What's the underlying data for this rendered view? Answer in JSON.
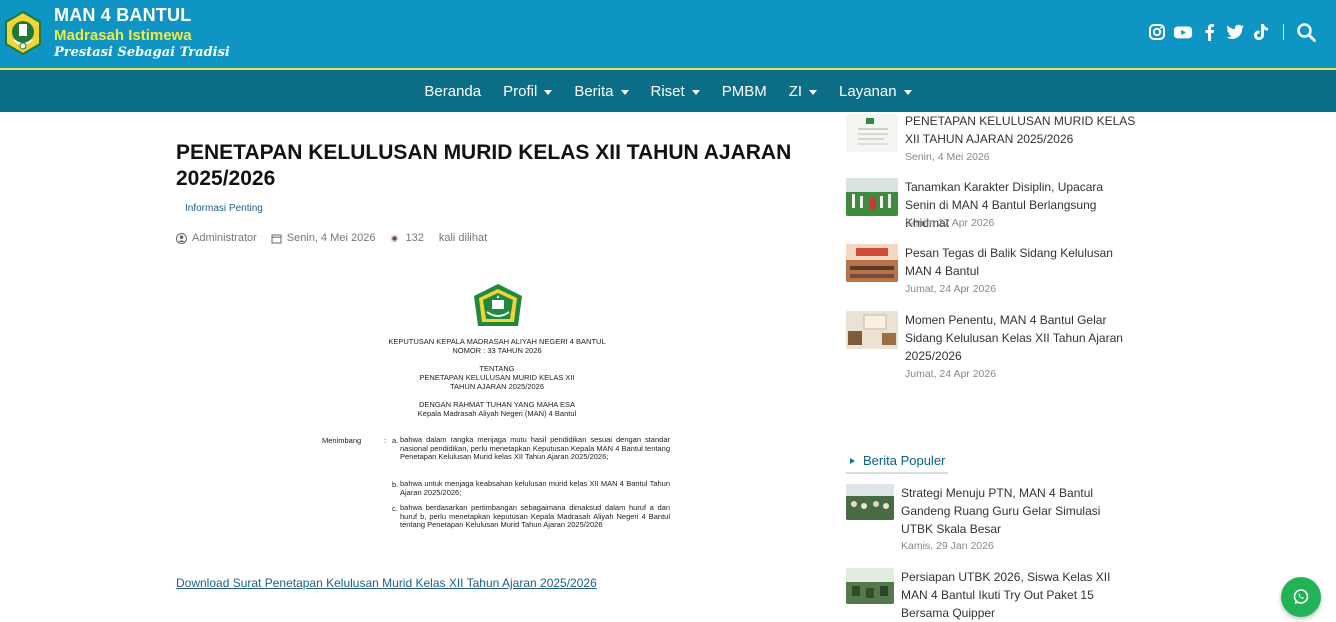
{
  "header": {
    "brand_name": "MAN 4 BANTUL",
    "brand_sub": "Madrasah Istimewa",
    "brand_tagline": "Prestasi Sebagai Tradisi",
    "social_icons": [
      "instagram-icon",
      "youtube-icon",
      "facebook-icon",
      "twitter-icon",
      "tiktok-icon"
    ],
    "colors": {
      "topbar": "#0e95c4",
      "nav": "#0c6d87",
      "accent": "#f4e93b"
    }
  },
  "nav": {
    "items": [
      {
        "label": "Beranda",
        "dropdown": false
      },
      {
        "label": "Profil",
        "dropdown": true
      },
      {
        "label": "Berita",
        "dropdown": true
      },
      {
        "label": "Riset",
        "dropdown": true
      },
      {
        "label": "PMBM",
        "dropdown": false
      },
      {
        "label": "ZI",
        "dropdown": true
      },
      {
        "label": "Layanan",
        "dropdown": true
      }
    ]
  },
  "article": {
    "title": "PENETAPAN KELULUSAN MURID KELAS XII TAHUN AJARAN 2025/2026",
    "category": "Informasi Penting",
    "author": "Administrator",
    "date": "Senin, 4 Mei 2026",
    "views": "132",
    "views_label": "kali dilihat",
    "document": {
      "heading_1": "KEPUTUSAN KEPALA MADRASAH ALIYAH NEGERI 4 BANTUL",
      "heading_2": "NOMOR : 33 TAHUN 2026",
      "tentang": "TENTANG",
      "subject_1": "PENETAPAN KELULUSAN MURID KELAS XII",
      "subject_2": "TAHUN AJARAN 2025/2026",
      "blessing_1": "DENGAN RAHMAT TUHAN YANG MAHA ESA",
      "blessing_2": "Kepala Madrasah Aliyah Negeri (MAN) 4 Bantul",
      "menimbang_label": "Menimbang",
      "colon": ":",
      "points": [
        {
          "letter": "a.",
          "text": "bahwa dalam rangka menjaga mutu hasil pendidikan sesuai dengan standar nasional pendidikan, perlu menetapkan Keputusan Kepala MAN 4 Bantul tentang Penetapan Kelulusan Murid kelas XII Tahun Ajaran 2025/2026;"
        },
        {
          "letter": "b.",
          "text": "bahwa untuk menjaga keabsahan kelulusan murid kelas XII MAN 4 Bantul Tahun Ajaran 2025/2026;"
        },
        {
          "letter": "c.",
          "text": "bahwa berdasarkan pertimbangan sebagaimana dimaksud dalam huruf a dan huruf b, perlu menetapkan keputusan Kepala Madrasah Aliyah Negeri 4 Bantul tentang Penetapan Kelulusan Murid Tahun Ajaran 2025/2026"
        }
      ]
    },
    "download_link": "Download Surat Penetapan Kelulusan Murid Kelas XII Tahun Ajaran 2025/2026"
  },
  "sidebar": {
    "latest": [
      {
        "title": "PENETAPAN KELULUSAN MURID KELAS XII TAHUN AJARAN 2025/2026",
        "date": "Senin, 4 Mei 2026"
      },
      {
        "title": "Tanamkan Karakter Disiplin, Upacara Senin di MAN 4 Bantul Berlangsung Khidmat",
        "date": "Senin, 27 Apr 2026"
      },
      {
        "title": "Pesan Tegas di Balik Sidang Kelulusan MAN 4 Bantul",
        "date": "Jumat, 24 Apr 2026"
      },
      {
        "title": "Momen Penentu, MAN 4 Bantul Gelar Sidang Kelulusan Kelas XII Tahun Ajaran 2025/2026",
        "date": "Jumat, 24 Apr 2026"
      }
    ],
    "popular_heading": "Berita Populer",
    "popular": [
      {
        "title": "Strategi Menuju PTN, MAN 4 Bantul Gandeng Ruang Guru Gelar Simulasi UTBK Skala Besar",
        "date": "Kamis, 29 Jan 2026"
      },
      {
        "title": "Persiapan UTBK 2026, Siswa Kelas XII MAN 4 Bantul Ikuti Try Out Paket 15 Bersama Quipper",
        "date": ""
      }
    ]
  },
  "whatsapp_icon": "whatsapp-icon"
}
